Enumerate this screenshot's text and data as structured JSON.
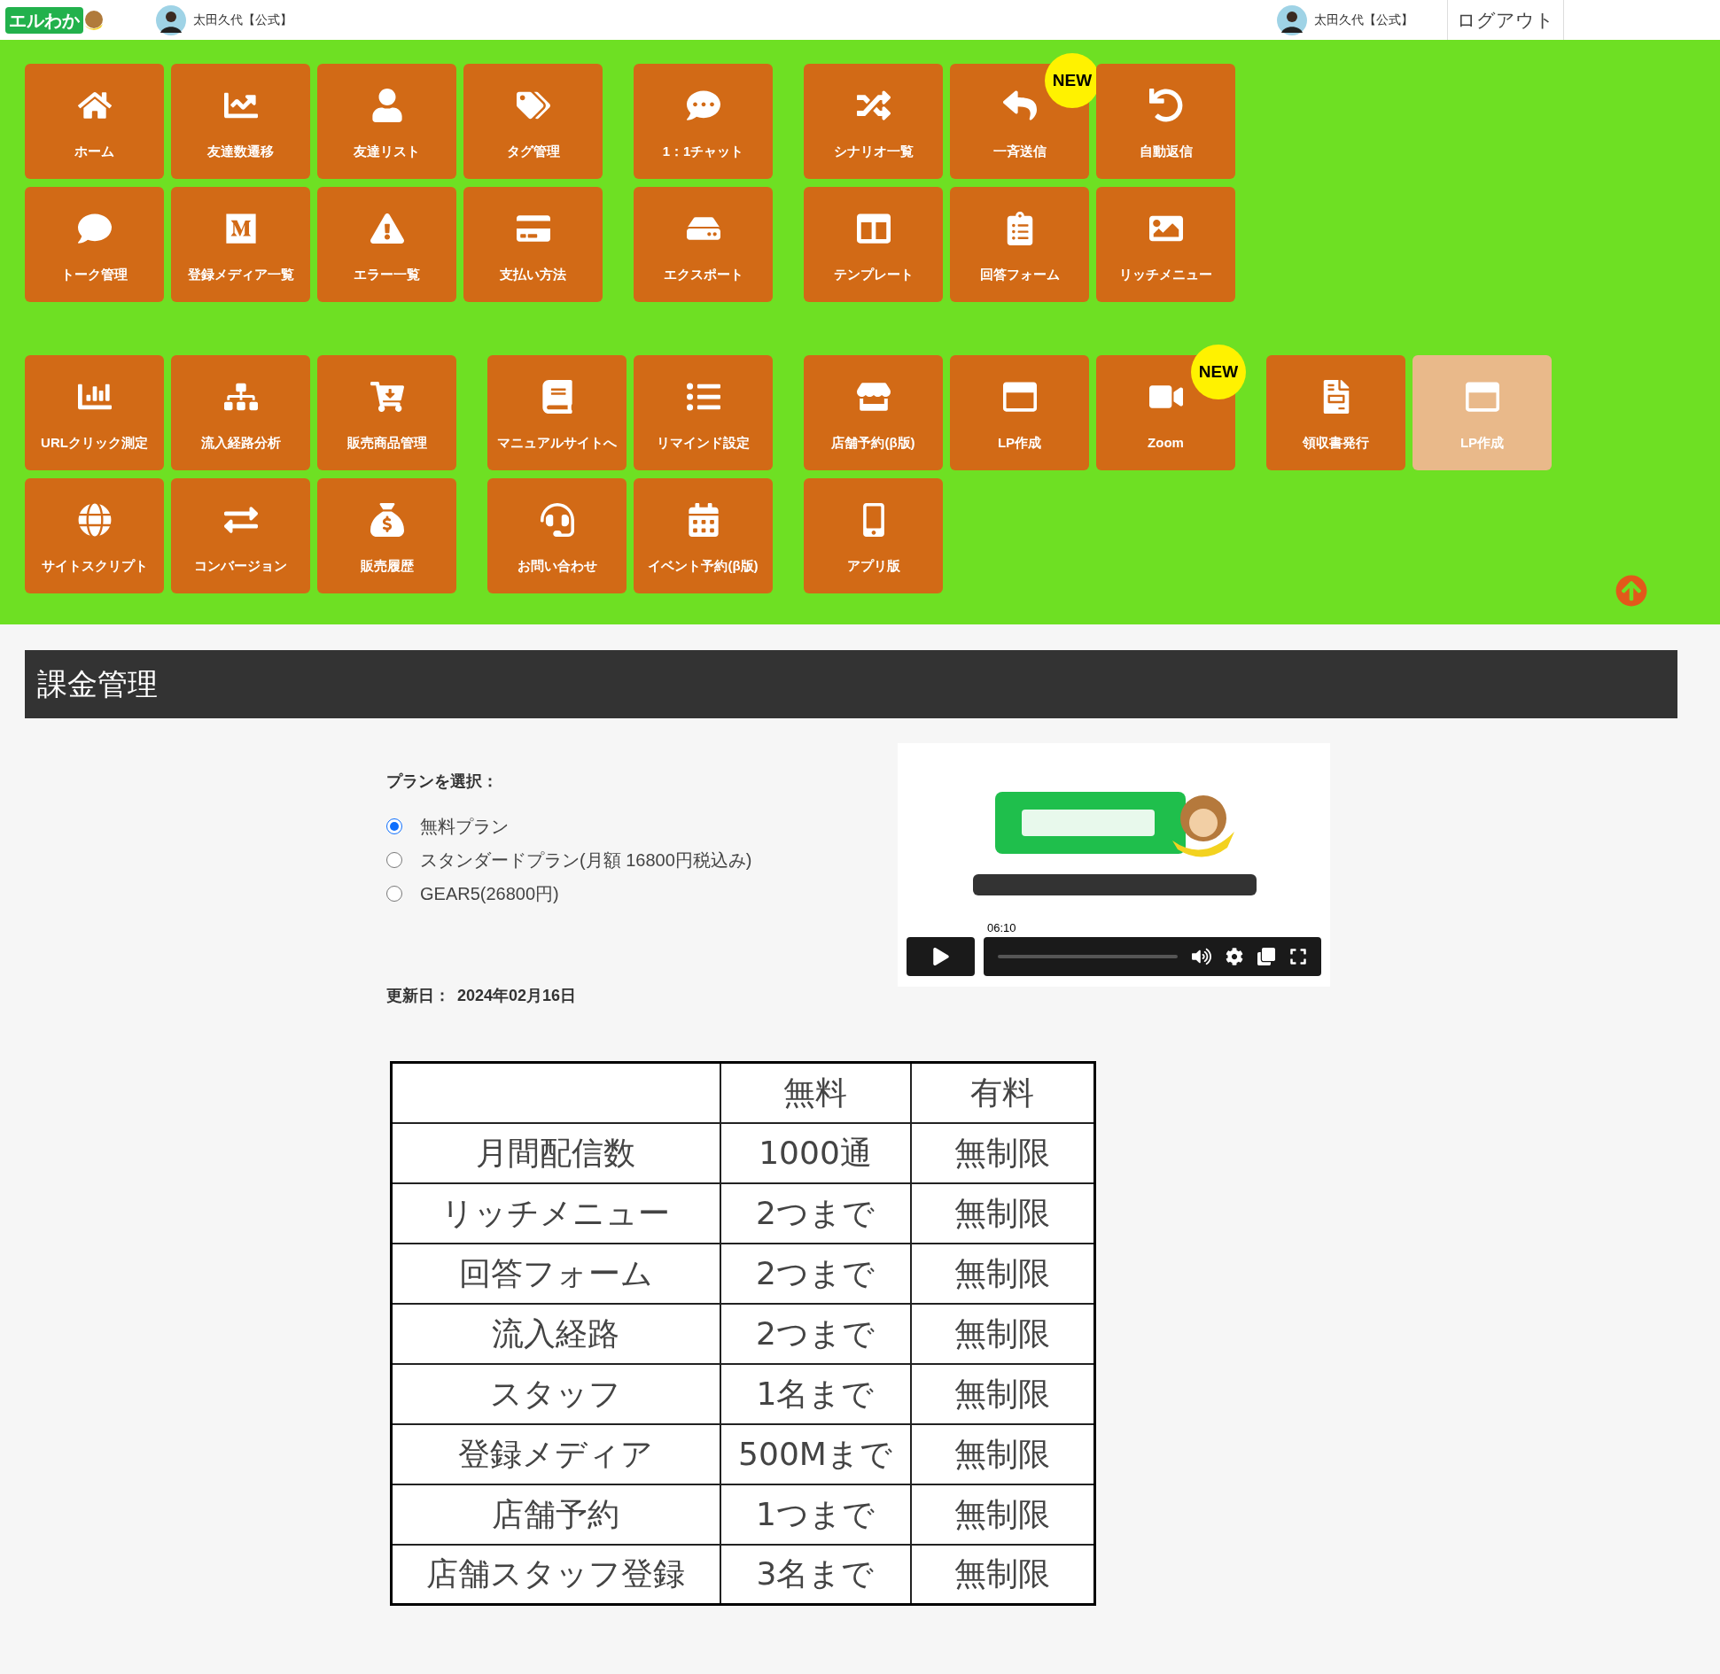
{
  "topbar": {
    "logo_text": "エルわか",
    "user_left": "太田久代【公式】",
    "user_right": "太田久代【公式】",
    "logout": "ログアウト"
  },
  "menu_sections": [
    {
      "groups": [
        {
          "rows": [
            [
              {
                "label": "ホーム"
              },
              {
                "label": "友達数遷移"
              },
              {
                "label": "友達リスト"
              },
              {
                "label": "タグ管理"
              }
            ],
            [
              {
                "label": "トーク管理"
              },
              {
                "label": "登録メディア一覧"
              },
              {
                "label": "エラー一覧"
              },
              {
                "label": "支払い方法"
              }
            ]
          ]
        },
        {
          "rows": [
            [
              {
                "label": "1：1チャット"
              }
            ],
            [
              {
                "label": "エクスポート"
              }
            ]
          ]
        },
        {
          "rows": [
            [
              {
                "label": "シナリオ一覧"
              },
              {
                "label": "一斉送信",
                "badge": "NEW"
              },
              {
                "label": "自動返信"
              }
            ],
            [
              {
                "label": "テンプレート"
              },
              {
                "label": "回答フォーム"
              },
              {
                "label": "リッチメニュー"
              }
            ]
          ]
        }
      ]
    },
    {
      "groups": [
        {
          "rows": [
            [
              {
                "label": "URLクリック測定"
              },
              {
                "label": "流入経路分析"
              },
              {
                "label": "販売商品管理"
              }
            ],
            [
              {
                "label": "サイトスクリプト"
              },
              {
                "label": "コンバージョン"
              },
              {
                "label": "販売履歴"
              }
            ]
          ]
        },
        {
          "rows": [
            [
              {
                "label": "マニュアルサイトへ"
              },
              {
                "label": "リマインド設定"
              }
            ],
            [
              {
                "label": "お問い合わせ"
              },
              {
                "label": "イベント予約(β版)"
              }
            ]
          ]
        },
        {
          "rows": [
            [
              {
                "label": "店舗予約(β版)"
              },
              {
                "label": "LP作成"
              },
              {
                "label": "Zoom",
                "badge": "NEW"
              }
            ],
            [
              {
                "label": "アプリ版"
              }
            ]
          ]
        },
        {
          "rows": [
            [
              {
                "label": "領収書発行"
              },
              {
                "label": "LP作成",
                "disabled": true
              }
            ]
          ]
        }
      ]
    }
  ],
  "page_title": "課金管理",
  "plan": {
    "heading": "プランを選択：",
    "options": [
      {
        "label": "無料プラン",
        "selected": true
      },
      {
        "label": "スタンダードプラン(月額 16800円税込み)",
        "selected": false
      },
      {
        "label": "GEAR5(26800円)",
        "selected": false
      }
    ]
  },
  "video": {
    "kind": "picture",
    "time": "06:10"
  },
  "updated": {
    "label": "更新日：",
    "date": "2024年02月16日"
  },
  "table": {
    "columns": [
      "無料",
      "有料"
    ],
    "rows": [
      {
        "label": "月間配信数",
        "values": [
          "1000通",
          "無制限"
        ]
      },
      {
        "label": "リッチメニュー",
        "values": [
          "2つまで",
          "無制限"
        ]
      },
      {
        "label": "回答フォーム",
        "values": [
          "2つまで",
          "無制限"
        ]
      },
      {
        "label": "流入経路",
        "values": [
          "2つまで",
          "無制限"
        ]
      },
      {
        "label": "スタッフ",
        "values": [
          "1名まで",
          "無制限"
        ]
      },
      {
        "label": "登録メディア",
        "values": [
          "500Mまで",
          "無制限"
        ]
      },
      {
        "label": "店舗予約",
        "values": [
          "1つまで",
          "無制限"
        ]
      },
      {
        "label": "店舗スタッフ登録",
        "values": [
          "3名まで",
          "無制限"
        ]
      }
    ]
  }
}
